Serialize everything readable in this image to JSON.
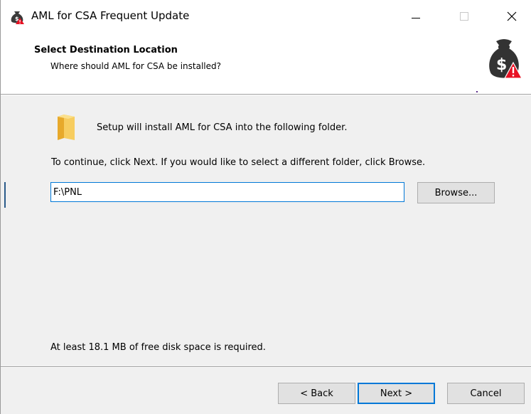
{
  "window": {
    "title": "AML for CSA Frequent Update",
    "controls": {
      "minimize": "minimize-icon",
      "maximize": "maximize-icon",
      "close_glyph": "✕"
    }
  },
  "header": {
    "title": "Select Destination Location",
    "subtitle": "Where should AML for CSA be installed?"
  },
  "body": {
    "intro": "Setup will install AML for CSA into the following folder.",
    "instruction": "To continue, click Next. If you would like to select a different folder, click Browse.",
    "path_value": "F:\\PNL",
    "browse_label": "Browse...",
    "disk_space": "At least 18.1 MB of free disk space is required."
  },
  "footer": {
    "back_label": "< Back",
    "next_label": "Next >",
    "cancel_label": "Cancel"
  },
  "colors": {
    "accent": "#0078d7",
    "warning": "#e81123",
    "folder": "#f5c453"
  }
}
